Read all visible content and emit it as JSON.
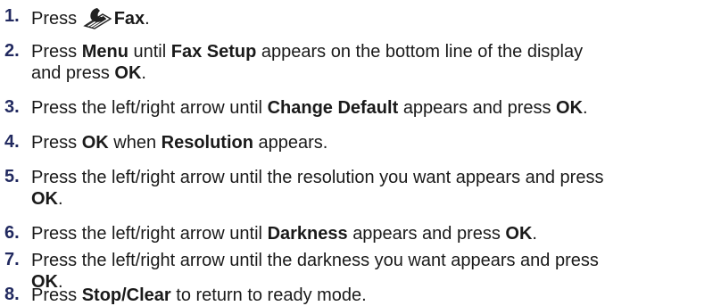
{
  "steps": [
    {
      "number": "1.",
      "line1": [
        "Press",
        "Fax",
        "."
      ]
    },
    {
      "number": "2.",
      "line1": [
        "Press",
        "Menu",
        "until",
        "Fax Setup",
        "appears on the bottom line of the display"
      ],
      "line2": [
        "and press",
        "OK",
        "."
      ]
    },
    {
      "number": "3.",
      "line1": [
        "Press the left/right arrow until",
        "Change Default",
        "appears and press",
        "OK",
        "."
      ]
    },
    {
      "number": "4.",
      "line1": [
        "Press",
        "OK",
        "when",
        "Resolution",
        "appears."
      ]
    },
    {
      "number": "5.",
      "line1": [
        "Press the left/right arrow until the resolution you want appears and press"
      ],
      "line2": [
        "OK",
        "."
      ]
    },
    {
      "number": "6.",
      "line1": [
        "Press the left/right arrow until",
        "Darkness",
        "appears and press",
        "OK",
        "."
      ]
    },
    {
      "number": "7.",
      "line1": [
        "Press the left/right arrow until the darkness you want appears and press"
      ],
      "line2": [
        "OK",
        "."
      ]
    },
    {
      "number": "8.",
      "line1": [
        "Press",
        "Stop/Clear",
        "to return to ready mode."
      ]
    }
  ],
  "icons": {
    "fax_button": "fax-handset-icon"
  }
}
